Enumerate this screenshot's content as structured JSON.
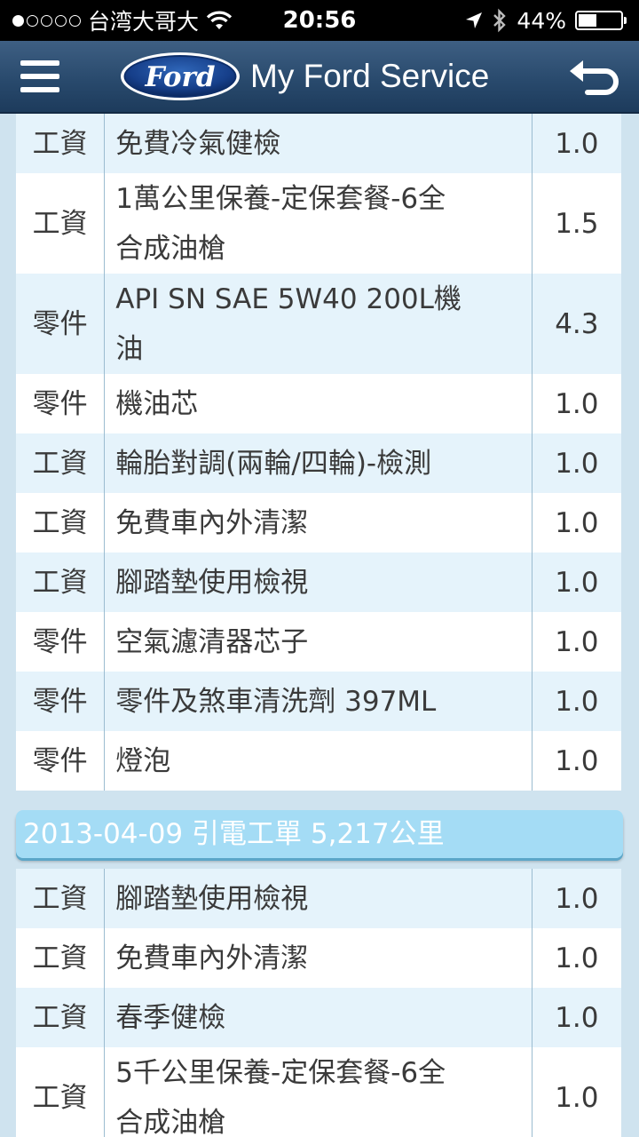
{
  "status_bar": {
    "carrier": "台湾大哥大",
    "time": "20:56",
    "battery": "44%",
    "battery_level": 0.44
  },
  "nav": {
    "logo_text": "Ford",
    "title": "My Ford Service"
  },
  "records_top": [
    {
      "type": "工資",
      "lines": [
        "免費冷氣健檢"
      ],
      "qty": "1.0"
    },
    {
      "type": "工資",
      "lines": [
        "1萬公里保養-定保套餐-6全",
        "合成油槍"
      ],
      "qty": "1.5"
    },
    {
      "type": "零件",
      "lines": [
        "API SN SAE 5W40 200L機",
        "油"
      ],
      "qty": "4.3"
    },
    {
      "type": "零件",
      "lines": [
        "機油芯"
      ],
      "qty": "1.0"
    },
    {
      "type": "工資",
      "lines": [
        "輪胎對調(兩輪/四輪)-檢測"
      ],
      "qty": "1.0"
    },
    {
      "type": "工資",
      "lines": [
        "免費車內外清潔"
      ],
      "qty": "1.0"
    },
    {
      "type": "工資",
      "lines": [
        "腳踏墊使用檢視"
      ],
      "qty": "1.0"
    },
    {
      "type": "零件",
      "lines": [
        "空氣濾清器芯子"
      ],
      "qty": "1.0"
    },
    {
      "type": "零件",
      "lines": [
        "零件及煞車清洗劑 397ML"
      ],
      "qty": "1.0"
    },
    {
      "type": "零件",
      "lines": [
        "燈泡"
      ],
      "qty": "1.0"
    }
  ],
  "section": {
    "header": "2013-04-09 引電工單 5,217公里"
  },
  "records_bottom": [
    {
      "type": "工資",
      "lines": [
        "腳踏墊使用檢視"
      ],
      "qty": "1.0"
    },
    {
      "type": "工資",
      "lines": [
        "免費車內外清潔"
      ],
      "qty": "1.0"
    },
    {
      "type": "工資",
      "lines": [
        "春季健檢"
      ],
      "qty": "1.0"
    },
    {
      "type": "工資",
      "lines": [
        "5千公里保養-定保套餐-6全",
        "合成油槍"
      ],
      "qty": "1.0"
    }
  ]
}
